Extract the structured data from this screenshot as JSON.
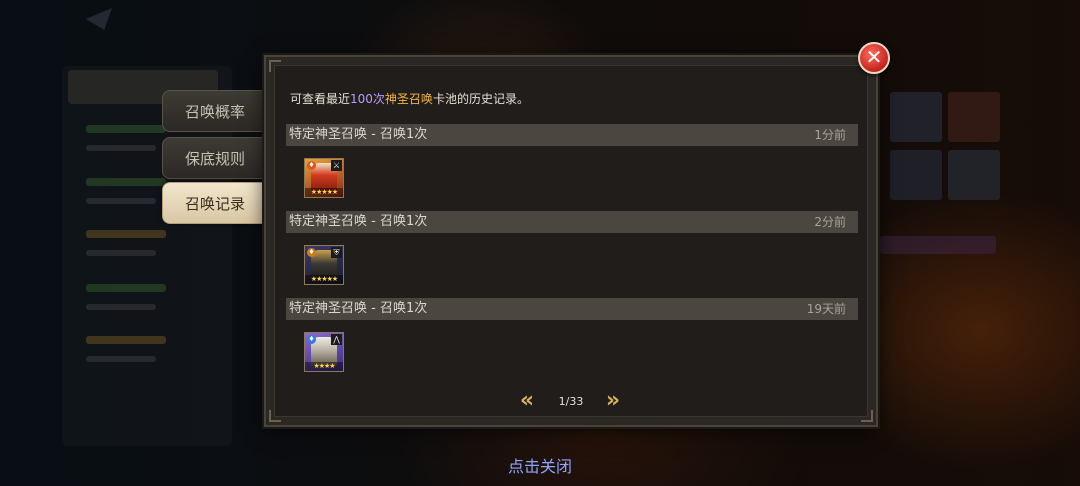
{
  "tabs": [
    {
      "label": "召唤概率"
    },
    {
      "label": "保底规则"
    },
    {
      "label": "召唤记录",
      "active": true
    }
  ],
  "info": {
    "prefix": "可查看最近",
    "count": "100次",
    "pool": "神圣召唤",
    "suffix": "卡池的历史记录。"
  },
  "records": [
    {
      "title": "特定神圣召唤 - 召唤1次",
      "time": "1分前",
      "hero_icon": "hero-card-red-armored-knight",
      "stars": "★★★★★",
      "element": "fire"
    },
    {
      "title": "特定神圣召唤 - 召唤1次",
      "time": "2分前",
      "hero_icon": "hero-card-dark-armored-warrior",
      "stars": "★★★★★",
      "element": "dark"
    },
    {
      "title": "特定神圣召唤 - 召唤1次",
      "time": "19天前",
      "hero_icon": "hero-card-white-haired-elder",
      "stars": "★★★★",
      "element": "light"
    }
  ],
  "pagination": {
    "indicator": "1/33",
    "prev_icon": "double-chevron-left-icon",
    "next_icon": "double-chevron-right-icon"
  },
  "close": {
    "icon": "close-icon",
    "tap_label": "点击关闭"
  },
  "colors": {
    "highlight_count": "#b99cff",
    "highlight_pool": "#f2b640",
    "close_red": "#c4241e",
    "tap_label": "#8fa6ff"
  }
}
